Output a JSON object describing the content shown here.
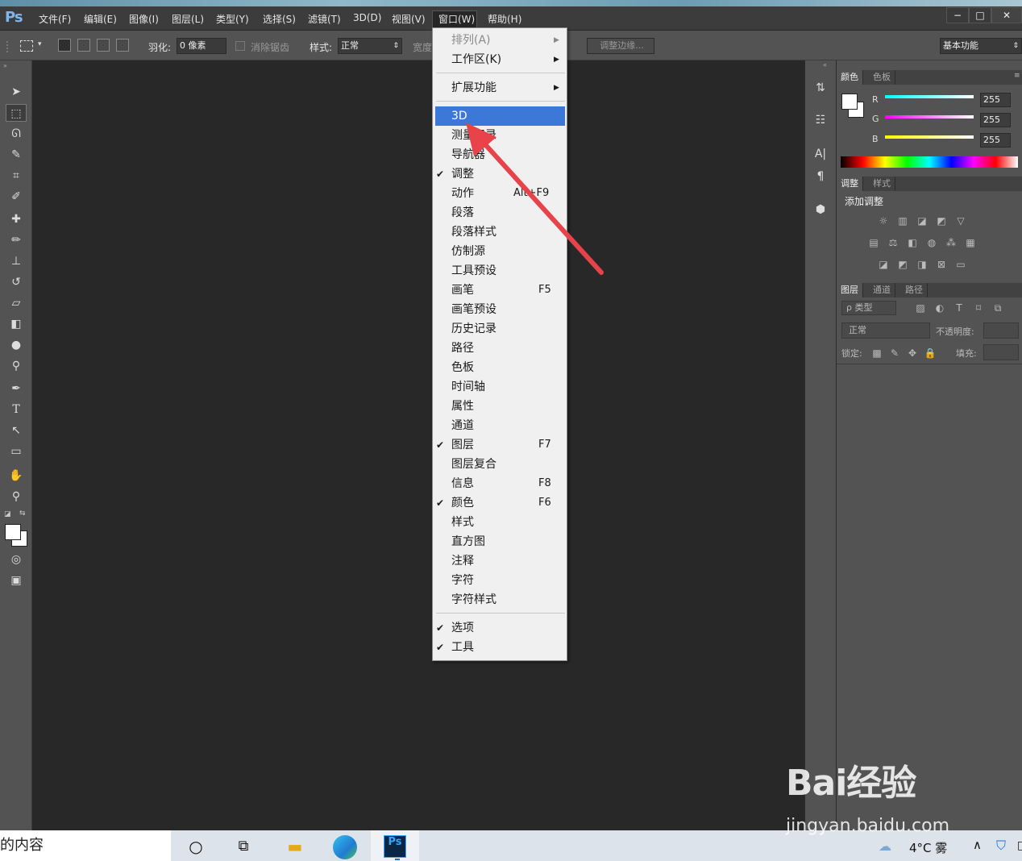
{
  "app": {
    "logo": "Ps"
  },
  "menubar": {
    "items": [
      "文件(F)",
      "编辑(E)",
      "图像(I)",
      "图层(L)",
      "类型(Y)",
      "选择(S)",
      "滤镜(T)",
      "3D(D)",
      "视图(V)",
      "窗口(W)",
      "帮助(H)"
    ]
  },
  "window_controls": {
    "minimize": "−",
    "maximize": "□",
    "close": "✕"
  },
  "options": {
    "feather_label": "羽化:",
    "feather_value": "0 像素",
    "antialias_label": "消除锯齿",
    "style_label": "样式:",
    "style_value": "正常",
    "width_label": "宽度",
    "refine_edge_label": "调整边缘...",
    "workspace_value": "基本功能"
  },
  "window_menu": {
    "items": [
      {
        "label": "排列(A)",
        "submenu": true,
        "disabled": true
      },
      {
        "label": "工作区(K)",
        "submenu": true
      },
      {
        "sep": true
      },
      {
        "label": "扩展功能",
        "submenu": true
      },
      {
        "sep": true
      },
      {
        "label": "3D",
        "highlighted": true
      },
      {
        "label": "测量记录"
      },
      {
        "label": "导航器"
      },
      {
        "label": "调整",
        "checked": true
      },
      {
        "label": "动作",
        "shortcut": "Alt+F9"
      },
      {
        "label": "段落"
      },
      {
        "label": "段落样式"
      },
      {
        "label": "仿制源"
      },
      {
        "label": "工具预设"
      },
      {
        "label": "画笔",
        "shortcut": "F5"
      },
      {
        "label": "画笔预设"
      },
      {
        "label": "历史记录"
      },
      {
        "label": "路径"
      },
      {
        "label": "色板"
      },
      {
        "label": "时间轴"
      },
      {
        "label": "属性"
      },
      {
        "label": "通道"
      },
      {
        "label": "图层",
        "checked": true,
        "shortcut": "F7"
      },
      {
        "label": "图层复合"
      },
      {
        "label": "信息",
        "shortcut": "F8"
      },
      {
        "label": "颜色",
        "checked": true,
        "shortcut": "F6"
      },
      {
        "label": "样式"
      },
      {
        "label": "直方图"
      },
      {
        "label": "注释"
      },
      {
        "label": "字符"
      },
      {
        "label": "字符样式"
      },
      {
        "sep": true
      },
      {
        "label": "选项",
        "checked": true
      },
      {
        "label": "工具",
        "checked": true
      }
    ]
  },
  "color_panel": {
    "tabs": [
      "颜色",
      "色板"
    ],
    "channels": [
      {
        "name": "R",
        "value": "255"
      },
      {
        "name": "G",
        "value": "255"
      },
      {
        "name": "B",
        "value": "255"
      }
    ]
  },
  "adjust_panel": {
    "tabs": [
      "调整",
      "样式"
    ],
    "title": "添加调整"
  },
  "layers_panel": {
    "tabs": [
      "图层",
      "通道",
      "路径"
    ],
    "filter_label": "ρ 类型",
    "blend_mode": "正常",
    "opacity_label": "不透明度:",
    "lock_label": "锁定:",
    "fill_label": "填充:"
  },
  "taskbar": {
    "search_text": "的内容",
    "weather": "4°C 雾"
  },
  "watermark": {
    "brand": "Bai经验",
    "url": "jingyan.baidu.com"
  },
  "colors": {
    "highlight": "#3c78d8",
    "arrow": "#e8424a"
  }
}
